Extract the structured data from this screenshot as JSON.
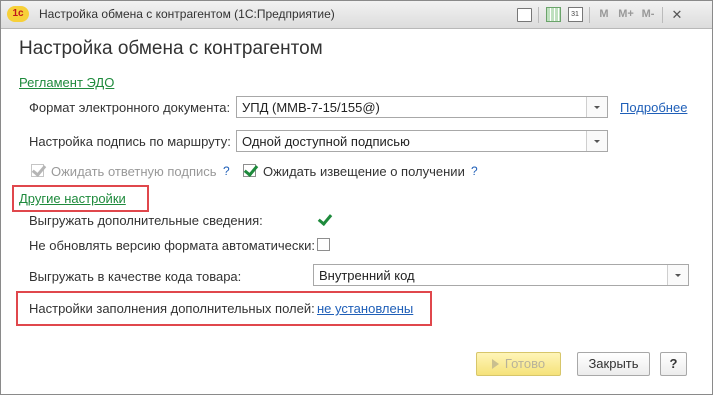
{
  "window": {
    "logo": "1с",
    "title": "Настройка обмена с контрагентом  (1С:Предприятие)",
    "toolbar": {
      "m": "M",
      "m_plus": "M+",
      "m_minus": "M-",
      "close": "✕"
    }
  },
  "form": {
    "title": "Настройка обмена с контрагентом"
  },
  "reglament": {
    "link": "Регламент ЭДО",
    "format_label": "Формат электронного документа:",
    "format_value": "УПД (ММВ-7-15/155@)",
    "more_link": "Подробнее",
    "sign_label": "Настройка подпись по маршруту:",
    "sign_value": "Одной доступной подписью",
    "await_sign_label": "Ожидать ответную подпись",
    "await_sign_help": "?",
    "await_notice_label": "Ожидать извещение о получении",
    "await_notice_help": "?"
  },
  "other": {
    "link": "Другие настройки",
    "export_extra_label": "Выгружать дополнительные сведения:",
    "no_update_label": "Не обновлять версию формата автоматически:",
    "product_code_label": "Выгружать в качестве кода товара:",
    "product_code_value": "Внутренний код",
    "extra_fields_label": "Настройки заполнения дополнительных полей:",
    "extra_fields_link": "не установлены"
  },
  "buttons": {
    "ok": "Готово",
    "close": "Закрыть",
    "help": "?"
  },
  "colors": {
    "accent_green": "#1e8a3c",
    "link_blue": "#1f5fb8",
    "highlight_red": "#e0474c",
    "primary_button": "#f5e27a"
  }
}
